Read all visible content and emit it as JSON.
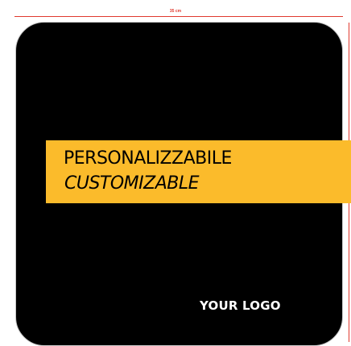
{
  "dimension": {
    "top_label": "35 cm",
    "line_color": "#e03a2f"
  },
  "mat": {
    "color": "#000000"
  },
  "banner": {
    "line1": "PERSONALIZZABILE",
    "line2": "CUSTOMIZABLE",
    "color": "#fbbb2b",
    "text_color": "#000000"
  },
  "logo": {
    "text": "YOUR LOGO",
    "color": "#ffffff"
  }
}
